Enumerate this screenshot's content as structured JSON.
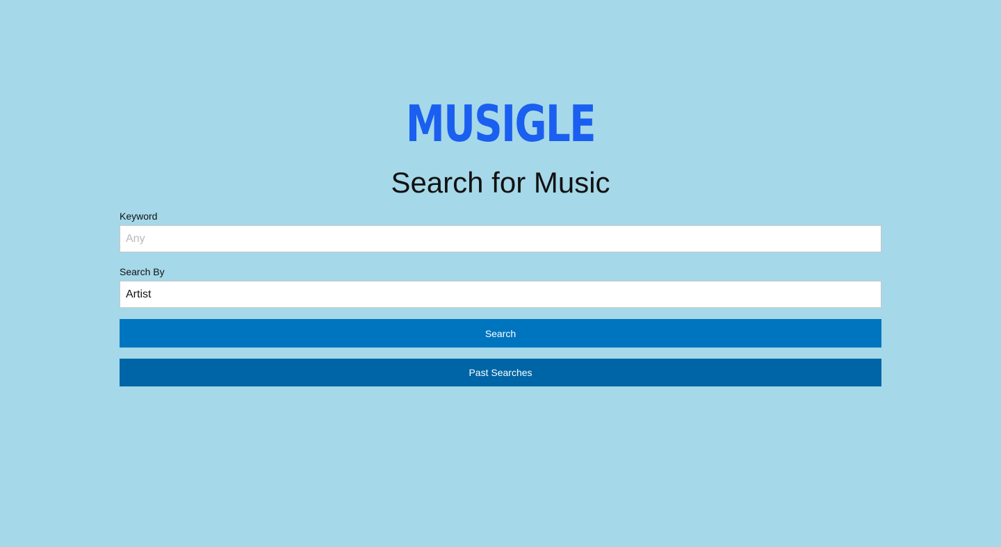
{
  "app": {
    "logo_text": "MUSIGLE",
    "page_title": "Search for Music"
  },
  "form": {
    "keyword": {
      "label": "Keyword",
      "value": "",
      "placeholder": "Any"
    },
    "search_by": {
      "label": "Search By",
      "selected": "Artist"
    },
    "search_button_label": "Search",
    "past_searches_button_label": "Past Searches"
  },
  "colors": {
    "background": "#a5d8e8",
    "logo": "#1a5ff0",
    "search_button": "#0075bf",
    "past_searches_button": "#0065a6"
  }
}
